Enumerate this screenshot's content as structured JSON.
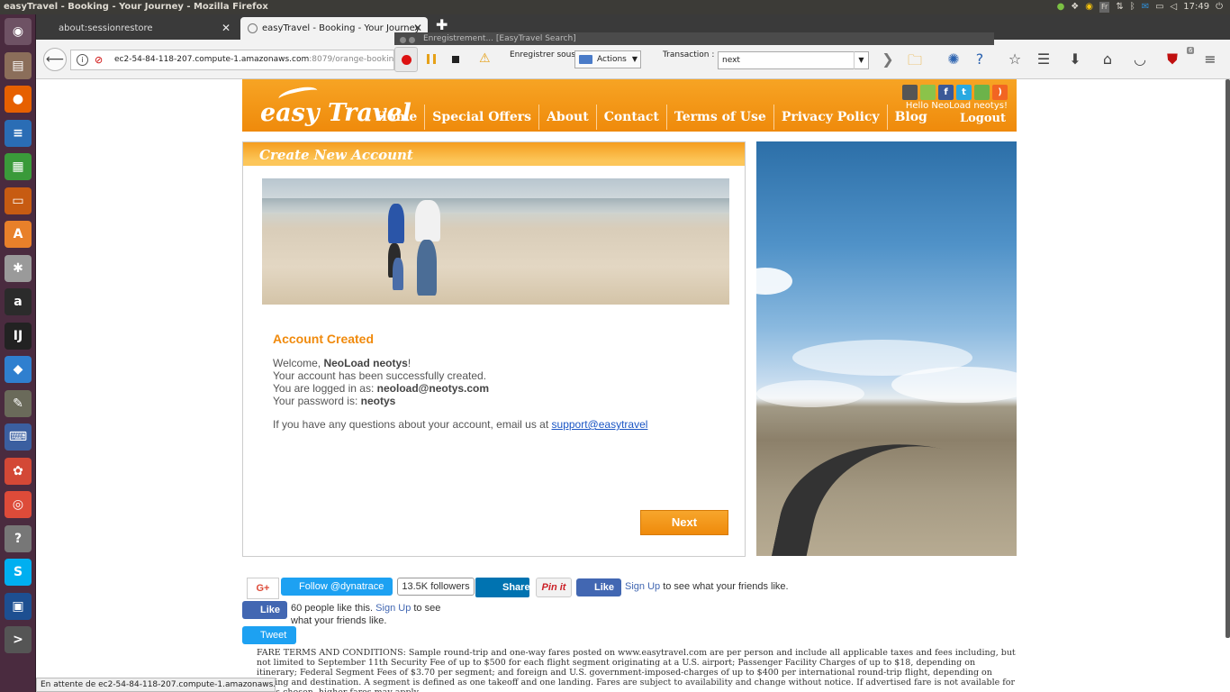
{
  "os": {
    "window_title": "easyTravel - Booking - Your Journey - Mozilla Firefox",
    "clock": "17:49",
    "keyboard_layout": "Fr"
  },
  "launcher": {
    "apps": [
      {
        "name": "dash",
        "glyph": "◉",
        "color": "#6e5264"
      },
      {
        "name": "files",
        "glyph": "▤",
        "color": "#8b6e5a"
      },
      {
        "name": "firefox",
        "glyph": "●",
        "color": "#e66000"
      },
      {
        "name": "writer",
        "glyph": "≡",
        "color": "#2a6db5"
      },
      {
        "name": "calc",
        "glyph": "▦",
        "color": "#3a9a3a"
      },
      {
        "name": "impress",
        "glyph": "▭",
        "color": "#c75b12"
      },
      {
        "name": "software-center",
        "glyph": "A",
        "color": "#e8802a"
      },
      {
        "name": "settings",
        "glyph": "✱",
        "color": "#9a9a9a"
      },
      {
        "name": "amazon",
        "glyph": "a",
        "color": "#2b2b2b"
      },
      {
        "name": "intellij",
        "glyph": "IJ",
        "color": "#222"
      },
      {
        "name": "dropbox",
        "glyph": "◆",
        "color": "#2f7fcf"
      },
      {
        "name": "gimp",
        "glyph": "✎",
        "color": "#6a6a5a"
      },
      {
        "name": "remote-desktop",
        "glyph": "⌨",
        "color": "#3b5fa0"
      },
      {
        "name": "picasa",
        "glyph": "✿",
        "color": "#d34836"
      },
      {
        "name": "chrome",
        "glyph": "◎",
        "color": "#dd4b39"
      },
      {
        "name": "help",
        "glyph": "?",
        "color": "#777"
      },
      {
        "name": "skype",
        "glyph": "S",
        "color": "#00aff0"
      },
      {
        "name": "virtualbox",
        "glyph": "▣",
        "color": "#1d4f91"
      },
      {
        "name": "terminal",
        "glyph": ">",
        "color": "#555"
      }
    ]
  },
  "browser": {
    "tabs": [
      {
        "label": "about:sessionrestore"
      },
      {
        "label": "easyTravel - Booking - Your Journey"
      }
    ],
    "url_host": "ec2-54-84-118-207.compute-1.amazonaws.com",
    "url_rest": ":8079/orange-booking-review",
    "status_text": "En attente de ec2-54-84-118-207.compute-1.amazonaws.com..."
  },
  "neoload": {
    "title": "Enregistrement... [EasyTravel  Search]",
    "save_label": "Enregistrer sous :",
    "actions_value": "Actions",
    "transaction_label": "Transaction :",
    "transaction_value": "next",
    "badge_count": "6"
  },
  "site": {
    "logo_text": "easy Travel",
    "nav": [
      "Home",
      "Special Offers",
      "About",
      "Contact",
      "Terms of Use",
      "Privacy Policy",
      "Blog"
    ],
    "greeting": "Hello NeoLoad neotys!",
    "logout_label": "Logout"
  },
  "account": {
    "section_title": "Create New Account",
    "heading": "Account Created",
    "welcome_prefix": "Welcome, ",
    "user_name": "NeoLoad neotys",
    "welcome_suffix": "!",
    "created_text": "Your account has been successfully created.",
    "logged_in_prefix": "You are logged in as: ",
    "email": "neoload@neotys.com",
    "password_prefix": "Your password is: ",
    "password": "neotys",
    "question_text": "If you have any questions about your account, email us at ",
    "support_link": "support@easytravel",
    "next_label": "Next"
  },
  "social": {
    "gplus": "G+",
    "follow_label": "Follow @dynatrace",
    "followers": "13.5K followers",
    "share_label": "Share",
    "pin_label": "Pin it",
    "like_label": "Like",
    "signup_label": "Sign Up",
    "friends_text": " to see what your friends like.",
    "people_like_text": "60 people like this. ",
    "signup_to_see": " to see",
    "friends_like_text": "what your friends like.",
    "tweet_label": "Tweet"
  },
  "footer": {
    "fare_terms": "FARE TERMS AND CONDITIONS: Sample round-trip and one-way fares posted on www.easytravel.com are per person and include all applicable taxes and fees including, but not limited to September 11th Security Fee of up to $500 for each flight segment originating at a U.S. airport; Passenger Facility Charges of up to $18, depending on itinerary; Federal Segment Fees of $3.70 per segment; and foreign and U.S. government-imposed-charges of up to $400 per international round-trip flight, depending on routing and destination. A segment is defined as one takeoff and one landing. Fares are subject to availability and change without notice. If advertised fare is not available for dates chosen, higher fares may apply."
  }
}
